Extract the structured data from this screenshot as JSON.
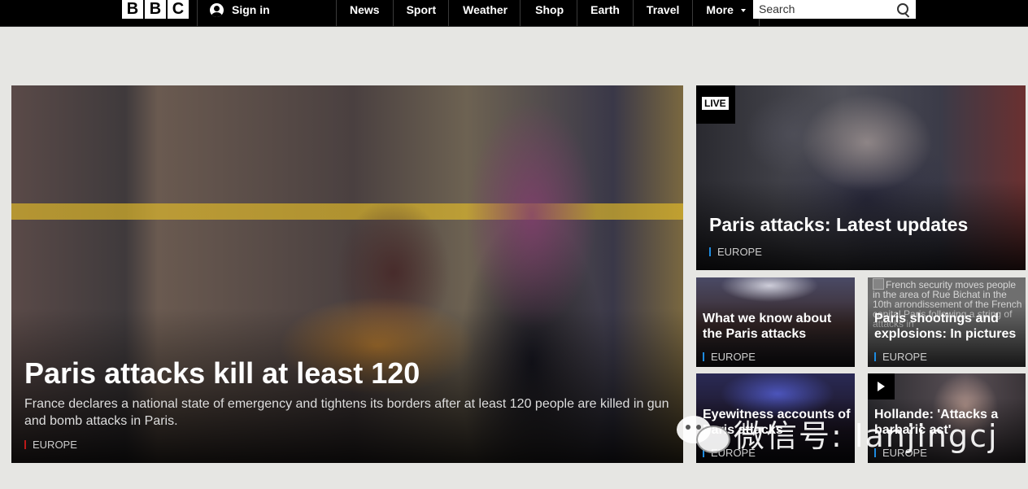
{
  "header": {
    "logo_letters": [
      "B",
      "B",
      "C"
    ],
    "sign_in": "Sign in",
    "nav": [
      {
        "label": "News"
      },
      {
        "label": "Sport"
      },
      {
        "label": "Weather"
      },
      {
        "label": "Shop"
      },
      {
        "label": "Earth"
      },
      {
        "label": "Travel"
      },
      {
        "label": "More"
      }
    ],
    "search_placeholder": "Search"
  },
  "main_story": {
    "title": "Paris attacks kill at least 120",
    "summary": "France declares a national state of emergency and tightens its borders after at least 120 people are killed in gun and bomb attacks in Paris.",
    "tag": "EUROPE"
  },
  "live_story": {
    "badge": "LIVE",
    "title": "Paris attacks: Latest updates",
    "tag": "EUROPE"
  },
  "small_stories": [
    {
      "title": "What we know about the Paris attacks",
      "tag": "EUROPE"
    },
    {
      "alt_text": "French security moves people in the area of Rue Bichat in the 10th arrondissement of the French capital Paris following a string of attacks in",
      "title": "Paris shootings and explosions: In pictures",
      "tag": "EUROPE"
    },
    {
      "title": "Eyewitness accounts of Paris attacks",
      "tag": "EUROPE"
    },
    {
      "title": "Hollande: 'Attacks a barbaric act'",
      "tag": "EUROPE"
    }
  ],
  "watermark": {
    "text": "微信号: lanjingcj"
  },
  "colors": {
    "background": "#e6e6e3",
    "header": "#000000",
    "news_red": "#bb1919",
    "sport_blue": "#1d8be0",
    "text_white": "#ffffff"
  },
  "icons": [
    "user-icon",
    "chevron-down-icon",
    "search-icon",
    "play-icon",
    "wechat-icon"
  ]
}
